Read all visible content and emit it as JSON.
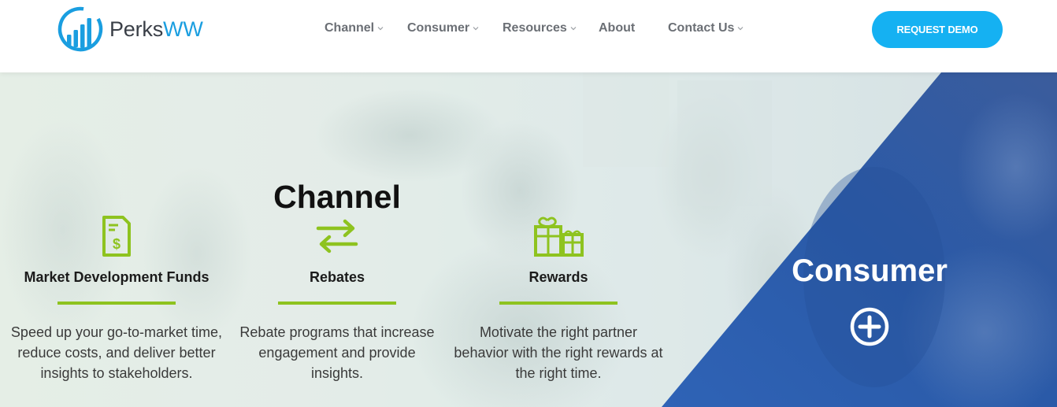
{
  "header": {
    "logo": {
      "text_main": "Perks",
      "text_accent": "WW",
      "mark_icon": "bar-chart-circle-icon"
    },
    "nav": [
      {
        "label": "Channel",
        "has_dropdown": true
      },
      {
        "label": "Consumer",
        "has_dropdown": true
      },
      {
        "label": "Resources",
        "has_dropdown": true
      },
      {
        "label": "About",
        "has_dropdown": false
      },
      {
        "label": "Contact Us",
        "has_dropdown": true
      }
    ],
    "cta_label": "REQUEST DEMO"
  },
  "hero": {
    "channel_title": "Channel",
    "columns": [
      {
        "icon": "dollar-document-icon",
        "title": "Market Development Funds",
        "description": "Speed up your go-to-market time, reduce costs, and deliver better insights to stakeholders."
      },
      {
        "icon": "exchange-arrows-icon",
        "title": "Rebates",
        "description": "Rebate programs that increase engagement and provide insights."
      },
      {
        "icon": "gift-icon",
        "title": "Rewards",
        "description": "Motivate the right partner behavior with the right rewards at the right time."
      }
    ],
    "consumer_title": "Consumer",
    "consumer_expand_icon": "plus-circle-icon"
  },
  "colors": {
    "accent_green": "#8ec31f",
    "cta_blue": "#15b1f2",
    "consumer_blue": "#2a5aa8",
    "logo_blue": "#1a9ee0"
  }
}
